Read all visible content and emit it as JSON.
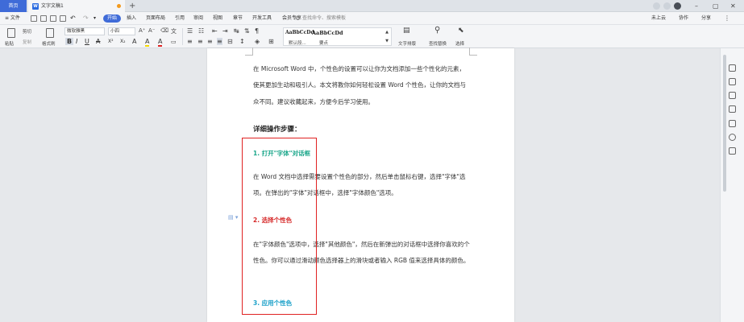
{
  "tabs": {
    "home": "首页",
    "doc_icon": "W",
    "doc_title": "文字文稿1",
    "add": "+"
  },
  "window": {
    "restore": "▢",
    "minimize": "–",
    "close": "✕"
  },
  "menu": {
    "file": "≡ 文件",
    "items": [
      "开始",
      "插入",
      "页面布局",
      "引用",
      "审阅",
      "视图",
      "章节",
      "开发工具",
      "会员专享"
    ],
    "search_placeholder": "查找命令、搜索模板",
    "right": [
      "未上云",
      "协作",
      "分享"
    ]
  },
  "ribbon": {
    "paste": "粘贴",
    "cut": "剪切",
    "copy": "复制",
    "format_painter": "格式刷",
    "font_name": "微软雅黑",
    "font_size": "小四",
    "format_buttons": [
      "B",
      "I",
      "U",
      "A",
      "X²",
      "X₂",
      "A",
      "A",
      "A"
    ],
    "style_samples": [
      "AaBbCcDd",
      "AaBbCcDd"
    ],
    "style_labels": [
      "默认段...",
      "要点"
    ],
    "text_layout": "文字排版",
    "find_replace": "查找替换",
    "select": "选择"
  },
  "document": {
    "intro": "在 Microsoft Word 中，个性色的设置可以让你为文档添加一些个性化的元素，使其更加生动和吸引人。本文将教你如何轻松设置 Word 个性色，让你的文档与众不同。建议收藏起来，方便今后学习使用。",
    "heading": "详细操作步骤：",
    "step1": "1. 打开\"字体\"对话框",
    "step1_text": "在 Word 文档中选择需要设置个性色的部分，然后单击鼠标右键，选择\"字体\"选项。在弹出的\"字体\"对话框中，选择\"字体颜色\"选项。",
    "step2": "2. 选择个性色",
    "step2_text": "在\"字体颜色\"选项中，选择\"其他颜色\"，然后在新弹出的对话框中选择你喜欢的个性色。你可以通过滑动颜色选择器上的滑块或者输入 RGB 值来选择具体的颜色。",
    "step3": "3. 应用个性色",
    "colors": {
      "step1": "#1aa68a",
      "step2": "#d62a2a",
      "step3": "#1aa0c8",
      "highlight_box": "#e02222",
      "accent": "#3f6bd8"
    }
  }
}
